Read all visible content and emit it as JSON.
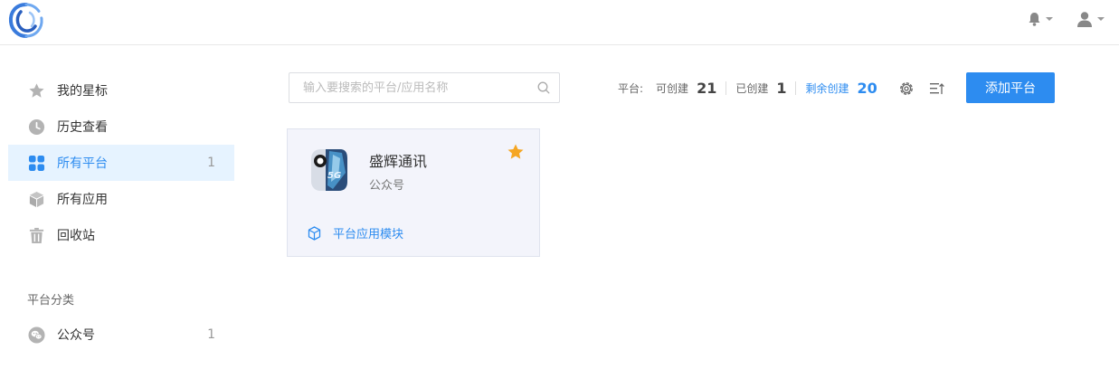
{
  "icons": {
    "logo": "logo-swirl",
    "notification": "bell-icon",
    "user": "user-icon"
  },
  "colors": {
    "primary": "#2d8cf0",
    "active_bg": "#e6f3ff",
    "star": "#f5a623",
    "card_bg": "#f3f4fb"
  },
  "sidebar": {
    "items": [
      {
        "label": "我的星标",
        "icon": "star-icon",
        "count": ""
      },
      {
        "label": "历史查看",
        "icon": "clock-icon",
        "count": ""
      },
      {
        "label": "所有平台",
        "icon": "grid-icon",
        "count": "1"
      },
      {
        "label": "所有应用",
        "icon": "cube-icon",
        "count": ""
      },
      {
        "label": "回收站",
        "icon": "trash-icon",
        "count": ""
      }
    ],
    "section_title": "平台分类",
    "categories": [
      {
        "label": "公众号",
        "icon": "wechat-icon",
        "count": "1"
      }
    ]
  },
  "search": {
    "placeholder": "输入要搜索的平台/应用名称",
    "value": ""
  },
  "stats": {
    "platform_label": "平台:",
    "can_create_label": "可创建",
    "can_create_value": "21",
    "created_label": "已创建",
    "created_value": "1",
    "remaining_label": "剩余创建",
    "remaining_value": "20"
  },
  "toolbar": {
    "add_button": "添加平台",
    "settings_icon": "gear-icon",
    "sort_icon": "sort-list-icon"
  },
  "card": {
    "title": "盛辉通讯",
    "subtitle": "公众号",
    "link_label": "平台应用模块",
    "starred": true
  }
}
